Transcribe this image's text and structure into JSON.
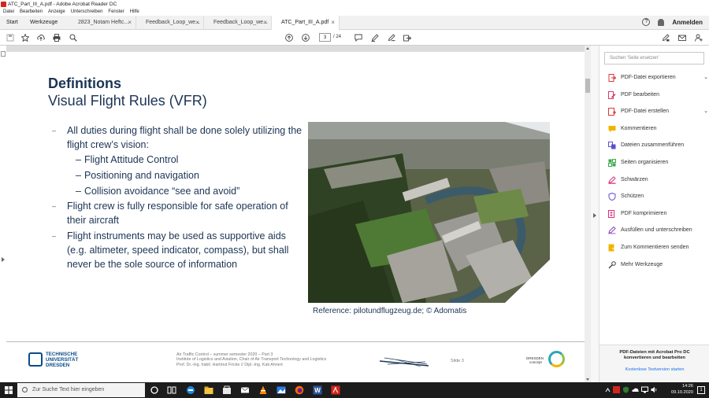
{
  "window": {
    "title": "ATC_Part_III_A.pdf - Adobe Acrobat Reader DC"
  },
  "menu": [
    "Datei",
    "Bearbeiten",
    "Anzeige",
    "Unterschreiben",
    "Fenster",
    "Hilfe"
  ],
  "nav": {
    "start": "Start",
    "werkzeuge": "Werkzeuge",
    "anmelden": "Anmelden"
  },
  "tabs": [
    {
      "label": "2823_Notam Heftc..."
    },
    {
      "label": "Feedback_Loop_we..."
    },
    {
      "label": "Feedback_Loop_we..."
    },
    {
      "label": "ATC_Part_III_A.pdf"
    }
  ],
  "toolbar": {
    "page_current": "3",
    "page_total": "/ 24"
  },
  "slide": {
    "heading": "Definitions",
    "subheading": "Visual Flight Rules (VFR)",
    "bullets": [
      {
        "text": "All duties during flight shall be done solely utilizing the flight crew’s vision:"
      },
      {
        "text": "Flight Attitude Control"
      },
      {
        "text": "Positioning and navigation"
      },
      {
        "text": "Collision avoidance “see and avoid”"
      },
      {
        "text": "Flight crew is fully responsible for safe operation of their aircraft"
      },
      {
        "text": "Flight instruments may be used as supportive aids (e.g. altimeter, speed indicator, compass), but shall never be the sole source of information"
      }
    ],
    "photo_reference": "Reference: pilotundflugzeug.de;  © Adomatis",
    "footer": {
      "university_lines": [
        "TECHNISCHE",
        "UNIVERSITÄT",
        "DRESDEN"
      ],
      "course_lines": [
        "Air Traffic Control – summer semester 2020 – Part 3",
        "Institute of Logistics and Aviation, Chair of Air Transport Technology and Logistics",
        "Prof. Dr.-Ing. habil. Hartmut Fricke // Dipl.-Ing. Kati Ahnert"
      ],
      "slide_number": "Slide 3",
      "city_logo_lines": [
        "DRESDEN",
        "concept"
      ]
    }
  },
  "right_panel": {
    "search_placeholder": "Suchen 'Seite ersetzen'",
    "tools": [
      {
        "label": "PDF-Datei exportieren",
        "icon": "export-pdf-icon",
        "color": "#d93a3a",
        "expandable": true
      },
      {
        "label": "PDF bearbeiten",
        "icon": "edit-pdf-icon",
        "color": "#d93a6a",
        "expandable": false
      },
      {
        "label": "PDF-Datei erstellen",
        "icon": "create-pdf-icon",
        "color": "#d93a3a",
        "expandable": true
      },
      {
        "label": "Kommentieren",
        "icon": "comment-icon",
        "color": "#f0b400",
        "expandable": false
      },
      {
        "label": "Dateien zusammenführen",
        "icon": "combine-icon",
        "color": "#5b4fd0",
        "expandable": false
      },
      {
        "label": "Seiten organisieren",
        "icon": "organize-icon",
        "color": "#3aa84b",
        "expandable": false
      },
      {
        "label": "Schwärzen",
        "icon": "redact-icon",
        "color": "#d9307a",
        "expandable": false
      },
      {
        "label": "Schützen",
        "icon": "protect-icon",
        "color": "#5b4fd0",
        "expandable": false
      },
      {
        "label": "PDF komprimieren",
        "icon": "compress-icon",
        "color": "#d9307a",
        "expandable": false
      },
      {
        "label": "Ausfüllen und unterschreiben",
        "icon": "fill-sign-icon",
        "color": "#8a3fc2",
        "expandable": false
      },
      {
        "label": "Zum Kommentieren senden",
        "icon": "send-comment-icon",
        "color": "#f0b400",
        "expandable": false
      },
      {
        "label": "Mehr Werkzeuge",
        "icon": "more-tools-icon",
        "color": "#444444",
        "expandable": false
      }
    ],
    "promo_text": "PDF-Dateien mit Acrobat Pro DC konvertieren und bearbeiten",
    "promo_link": "Kostenlose Testversion starten"
  },
  "taskbar": {
    "search_placeholder": "Zur Suche Text hier eingeben",
    "time": "14:26",
    "date": "09.10.2020",
    "notification_count": "1"
  },
  "colors": {
    "slide_text": "#1c3454",
    "link": "#1473e6",
    "acrobat_red": "#d4261c"
  }
}
